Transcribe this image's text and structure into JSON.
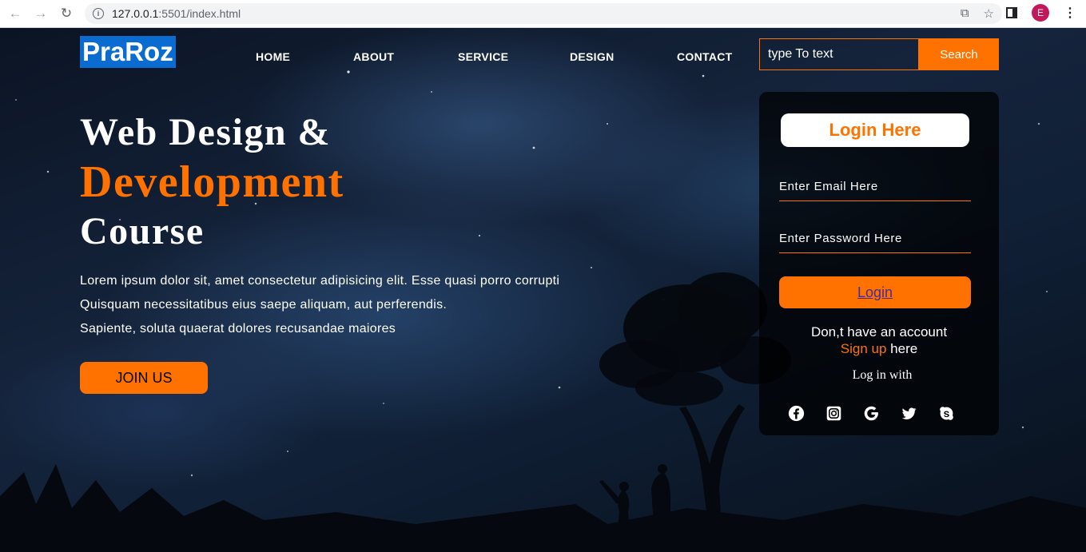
{
  "browser": {
    "url_host": "127.0.0.1",
    "url_rest": ":5501/index.html",
    "profile_initial": "E"
  },
  "navbar": {
    "logo": "PraRoz",
    "items": [
      {
        "label": "HOME"
      },
      {
        "label": "ABOUT"
      },
      {
        "label": "SERVICE"
      },
      {
        "label": "DESIGN"
      },
      {
        "label": "CONTACT"
      }
    ],
    "search_placeholder": "type To text",
    "search_button": "Search"
  },
  "hero": {
    "line1": "Web Design &",
    "line2": "Development",
    "line3": "Course",
    "paragraph": [
      "Lorem ipsum dolor sit, amet consectetur adipisicing elit. Esse quasi porro corrupti",
      "Quisquam necessitatibus eius saepe aliquam, aut perferendis.",
      "Sapiente, soluta quaerat dolores recusandae maiores"
    ],
    "cta": "JOIN US"
  },
  "login_form": {
    "title": "Login Here",
    "email_placeholder": "Enter Email Here",
    "password_placeholder": "Enter Password Here",
    "button": "Login",
    "no_account": "Don,t have an account",
    "signup_link": "Sign up",
    "signup_suffix": " here",
    "login_with": "Log in with",
    "socials": [
      "facebook-icon",
      "instagram-icon",
      "google-icon",
      "twitter-icon",
      "skype-icon"
    ]
  },
  "colors": {
    "accent": "#ff7200",
    "logo_bg": "#0a6bd1",
    "form_bg": "rgba(0,0,0,0.72)"
  }
}
